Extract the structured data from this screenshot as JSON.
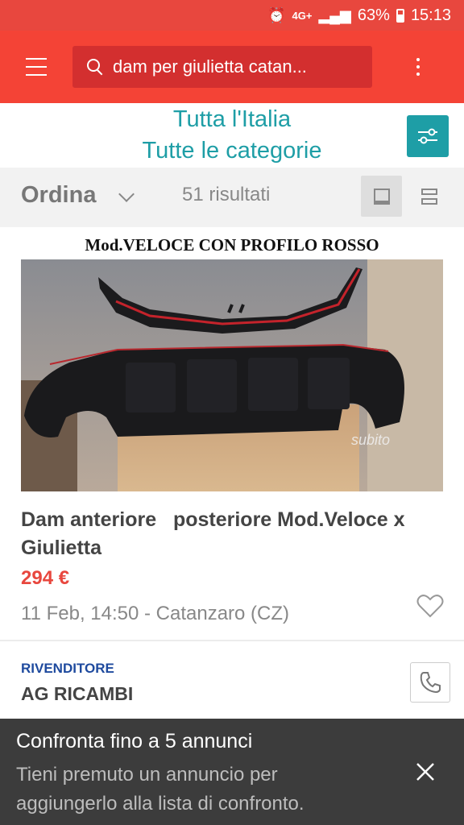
{
  "status_bar": {
    "network": "4G+",
    "battery": "63%",
    "time": "15:13"
  },
  "header": {
    "search_query": "dam per giulietta catan..."
  },
  "filters": {
    "location": "Tutta l'Italia",
    "category": "Tutte le categorie"
  },
  "sort_bar": {
    "sort_label": "Ordina",
    "results": "51 risultati"
  },
  "listing": {
    "image_caption": "Mod.VELOCE CON PROFILO ROSSO",
    "watermark": "subito",
    "title": "Dam anteriore   posteriore Mod.Veloce x Giulietta",
    "price": "294 €",
    "meta": "11 Feb, 14:50 - Catanzaro (CZ)",
    "seller_type": "RIVENDITORE",
    "seller_name": "AG RICAMBI"
  },
  "snackbar": {
    "title": "Confronta fino a 5 annunci",
    "body": "Tieni premuto un annuncio per aggiungerlo alla lista di confronto."
  },
  "colors": {
    "brand_red": "#f44336",
    "status_red": "#e8473e",
    "teal": "#1e9ea6",
    "seller_blue": "#1e4a9e",
    "price_red": "#e8473e"
  },
  "icons": [
    "alarm-icon",
    "signal-icon",
    "battery-icon",
    "menu-icon",
    "search-icon",
    "more-vert-icon",
    "filter-sliders-icon",
    "chevron-down-icon",
    "single-view-icon",
    "list-view-icon",
    "heart-icon",
    "phone-icon",
    "close-icon"
  ]
}
